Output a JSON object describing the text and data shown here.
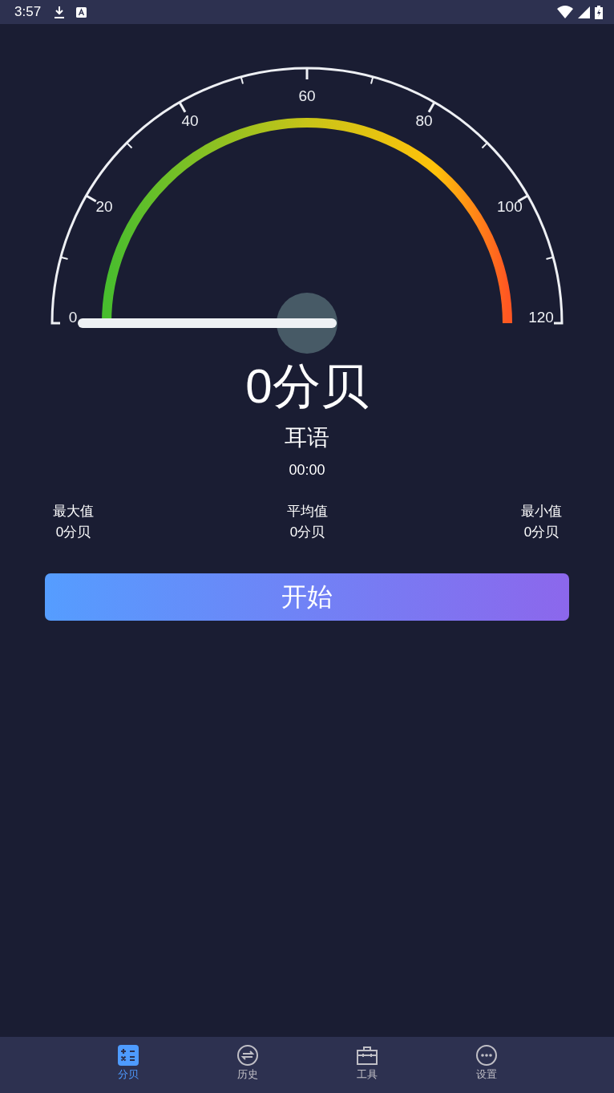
{
  "status_bar": {
    "time": "3:57"
  },
  "gauge": {
    "scale_labels": [
      "0",
      "20",
      "40",
      "60",
      "80",
      "100",
      "120"
    ]
  },
  "reading": "0分贝",
  "level_name": "耳语",
  "duration": "00:00",
  "stats": [
    {
      "label": "最大值",
      "value": "0分贝"
    },
    {
      "label": "平均值",
      "value": "0分贝"
    },
    {
      "label": "最小值",
      "value": "0分贝"
    }
  ],
  "start_button": "开始",
  "bottom_nav": [
    {
      "kind": "calculator",
      "label": "分贝",
      "selected": true
    },
    {
      "kind": "history",
      "label": "历史",
      "selected": false
    },
    {
      "kind": "toolbox",
      "label": "工具",
      "selected": false
    },
    {
      "kind": "more",
      "label": "设置",
      "selected": false
    }
  ]
}
